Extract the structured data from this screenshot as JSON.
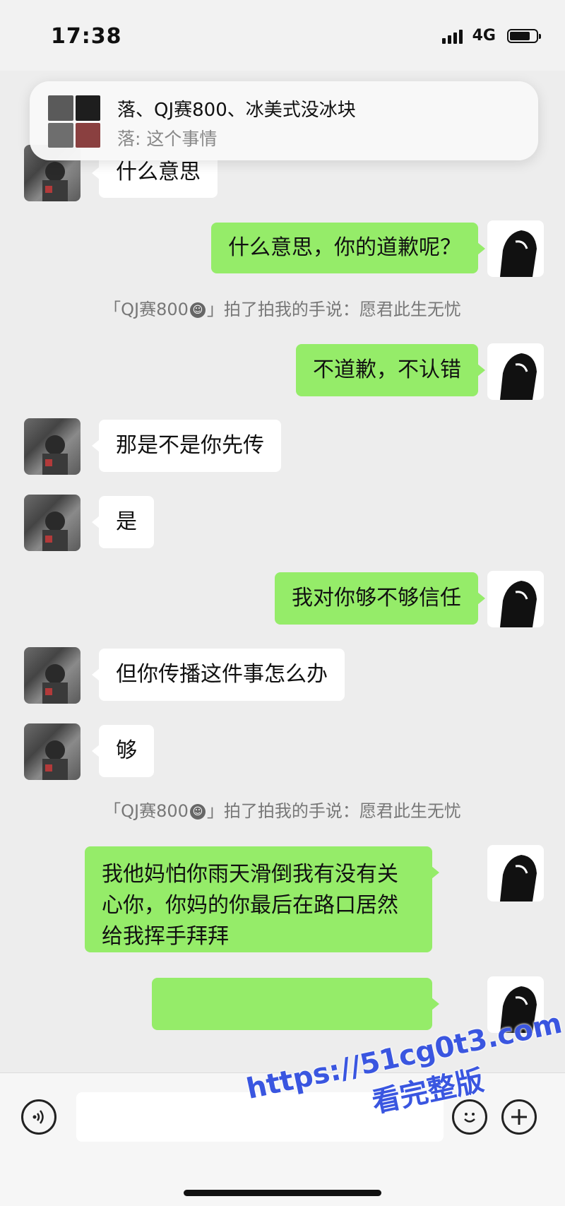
{
  "status_bar": {
    "time": "17:38",
    "network": "4G"
  },
  "notification": {
    "title": "落、QJ赛800、冰美式没冰块",
    "preview": "落: 这个事情"
  },
  "messages": [
    {
      "from": "them",
      "text": "什么意思"
    },
    {
      "from": "me",
      "text": "什么意思，你的道歉呢？"
    },
    {
      "type": "system",
      "pre": "「QJ赛800",
      "post": "」拍了拍我的手说：愿君此生无忧"
    },
    {
      "from": "me",
      "text": "不道歉，不认错"
    },
    {
      "from": "them",
      "text": "那是不是你先传"
    },
    {
      "from": "them",
      "text": "是"
    },
    {
      "from": "me",
      "text": "我对你够不够信任"
    },
    {
      "from": "them",
      "text": "但你传播这件事怎么办"
    },
    {
      "from": "them",
      "text": "够"
    },
    {
      "type": "system",
      "pre": "「QJ赛800",
      "post": "」拍了拍我的手说：愿君此生无忧"
    },
    {
      "from": "me",
      "text": "我他妈怕你雨天滑倒我有没有关心你，你妈的你最后在路口居然给我挥手拜拜"
    },
    {
      "from": "me",
      "text": ""
    }
  ],
  "input_bar": {
    "voice_icon": "voice-icon",
    "emoji_icon": "emoji-icon",
    "plus_icon": "plus-icon",
    "input_value": ""
  },
  "watermark": {
    "line1": "https://51cg0t3.com",
    "line2": "看完整版"
  },
  "colors": {
    "background": "#ededed",
    "my_bubble": "#95ec69",
    "their_bubble": "#ffffff",
    "watermark": "#3a56e0"
  }
}
